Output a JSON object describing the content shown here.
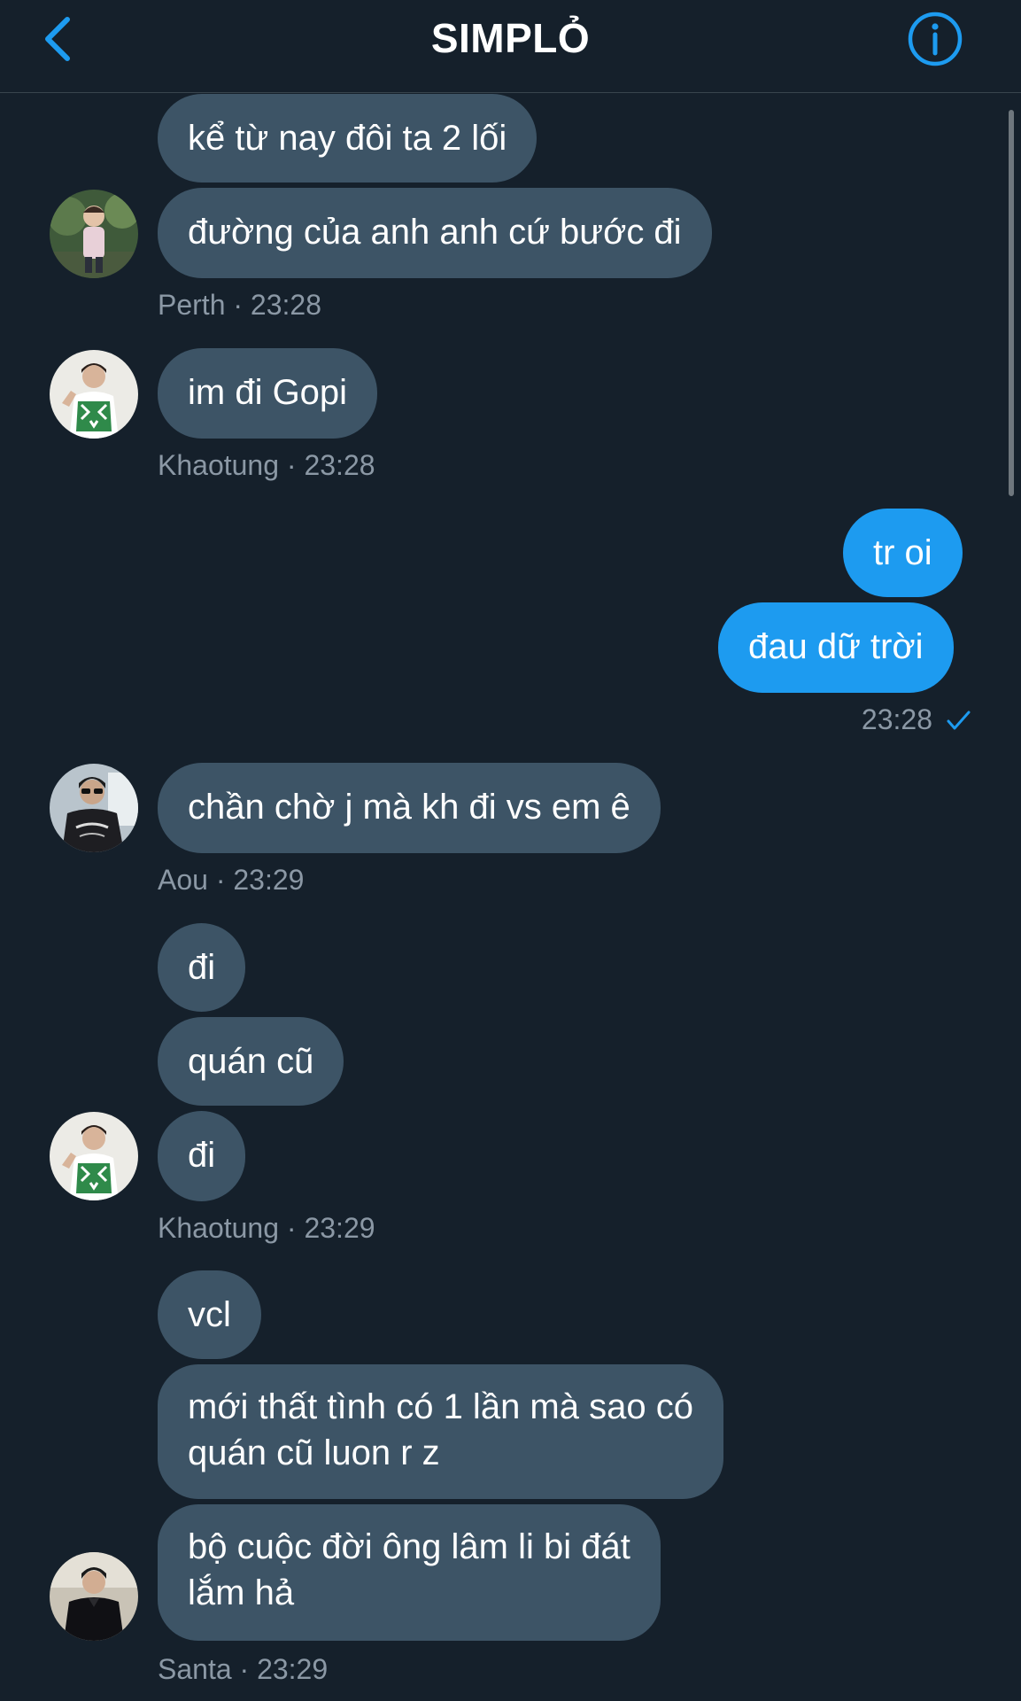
{
  "header": {
    "title": "SIMPLỎ",
    "back_icon": "chevron-left-icon",
    "info_icon": "info-circle-icon",
    "accent_color": "#1d9bf0"
  },
  "messages": [
    {
      "text": "kể từ nay đôi ta 2 lối"
    },
    {
      "text": "đường của anh anh cứ bước đi"
    },
    {
      "text": "im đi Gopi"
    },
    {
      "text": "tr oi"
    },
    {
      "text": "đau dữ trời"
    },
    {
      "text": "chần chờ j mà kh đi vs em ê"
    },
    {
      "text": "đi"
    },
    {
      "text": "quán cũ"
    },
    {
      "text": "đi"
    },
    {
      "text": "vcl"
    },
    {
      "text": "mới thất tình có 1 lần mà sao có\nquán cũ luon r z"
    },
    {
      "text": "bộ cuộc đời ông lâm li bi đát\nlắm hả"
    }
  ],
  "meta": [
    {
      "text": "Perth · 23:28"
    },
    {
      "text": "Khaotung · 23:28"
    },
    {
      "text": "23:28"
    },
    {
      "text": "Aou · 23:29"
    },
    {
      "text": "Khaotung · 23:29"
    },
    {
      "text": "Santa · 23:29"
    }
  ],
  "status": {
    "sent_icon": "checkmark-icon"
  }
}
